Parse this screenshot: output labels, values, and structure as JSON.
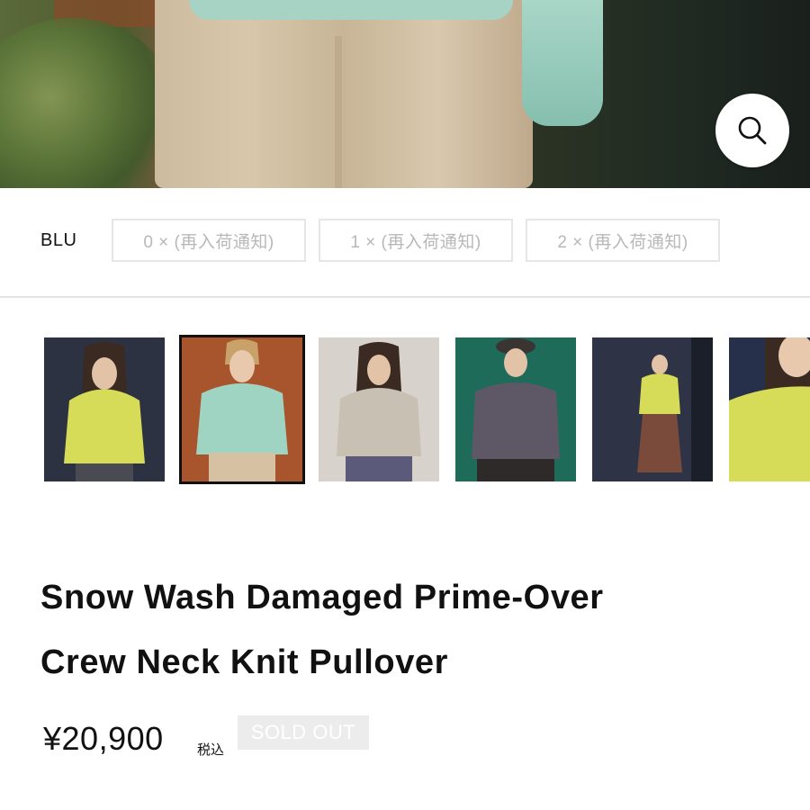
{
  "hero": {
    "icon": "search-icon"
  },
  "color_option": {
    "label": "BLU"
  },
  "sizes": [
    {
      "label": "0 × (再入荷通知)"
    },
    {
      "label": "1 × (再入荷通知)"
    },
    {
      "label": "2 × (再入荷通知)"
    }
  ],
  "thumbnails": [
    {
      "sweater_color": "#d6dc58",
      "bg": "#2c3242",
      "selected": false
    },
    {
      "sweater_color": "#9fd3c2",
      "bg": "#a8542c",
      "selected": true
    },
    {
      "sweater_color": "#c9c0b4",
      "bg": "#d7d2cc",
      "selected": false
    },
    {
      "sweater_color": "#5d5766",
      "bg": "#1e6b5a",
      "selected": false
    },
    {
      "sweater_color": "#d6dc58",
      "bg": "#2e3345",
      "selected": false
    },
    {
      "sweater_color": "#d6dc58",
      "bg": "#26304a",
      "selected": false
    }
  ],
  "product": {
    "title_line1": "Snow Wash Damaged Prime-Over",
    "title_line2": "Crew Neck Knit Pullover",
    "price": "¥20,900",
    "tax_label": "税込",
    "status": "SOLD OUT"
  }
}
